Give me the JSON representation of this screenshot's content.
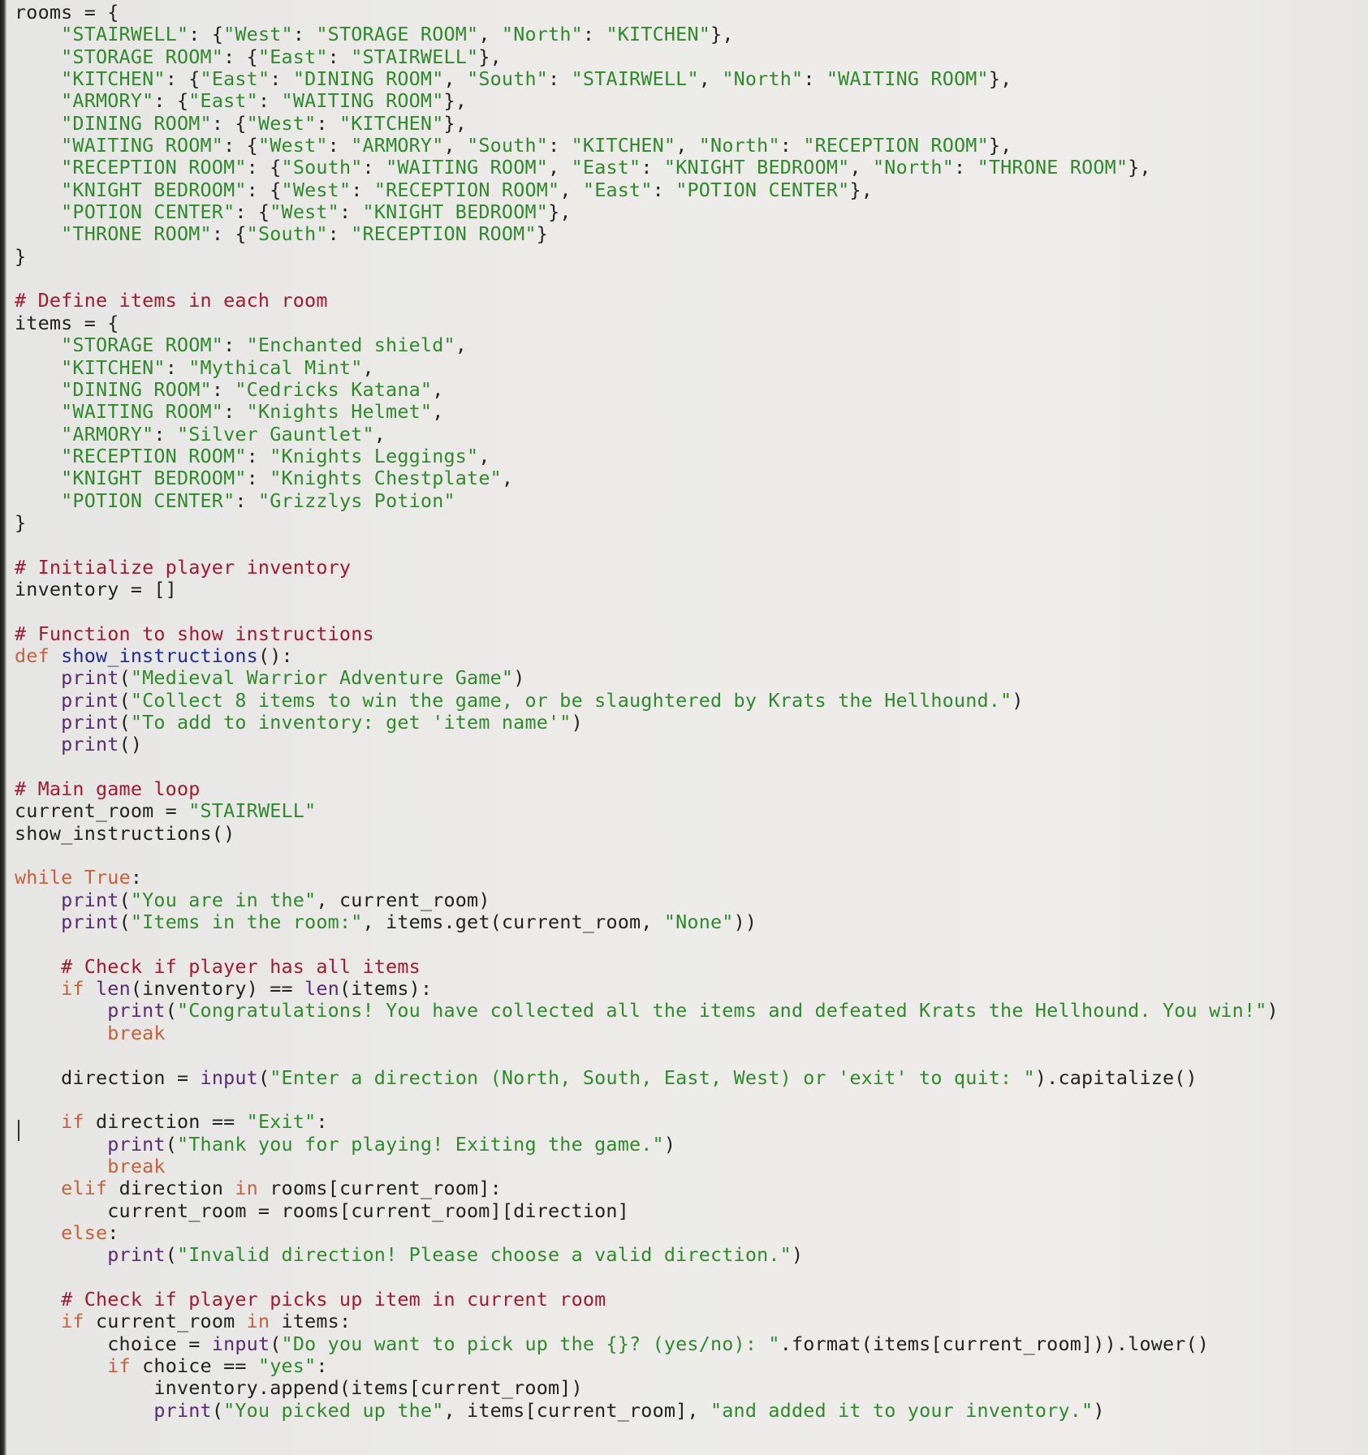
{
  "editor": {
    "language": "python",
    "colors": {
      "background": "#ecebe8",
      "plain": "#222222",
      "string": "#2f8a2c",
      "keyword": "#c9603a",
      "comment": "#a4192f",
      "builtin": "#5a2a72",
      "function_name": "#1f2b9a"
    },
    "lines": [
      [
        [
          "plain",
          "rooms = {"
        ]
      ],
      [
        [
          "plain",
          "    "
        ],
        [
          "str",
          "\"STAIRWELL\""
        ],
        [
          "plain",
          ": {"
        ],
        [
          "str",
          "\"West\""
        ],
        [
          "plain",
          ": "
        ],
        [
          "str",
          "\"STORAGE ROOM\""
        ],
        [
          "plain",
          ", "
        ],
        [
          "str",
          "\"North\""
        ],
        [
          "plain",
          ": "
        ],
        [
          "str",
          "\"KITCHEN\""
        ],
        [
          "plain",
          "},"
        ]
      ],
      [
        [
          "plain",
          "    "
        ],
        [
          "str",
          "\"STORAGE ROOM\""
        ],
        [
          "plain",
          ": {"
        ],
        [
          "str",
          "\"East\""
        ],
        [
          "plain",
          ": "
        ],
        [
          "str",
          "\"STAIRWELL\""
        ],
        [
          "plain",
          "},"
        ]
      ],
      [
        [
          "plain",
          "    "
        ],
        [
          "str",
          "\"KITCHEN\""
        ],
        [
          "plain",
          ": {"
        ],
        [
          "str",
          "\"East\""
        ],
        [
          "plain",
          ": "
        ],
        [
          "str",
          "\"DINING ROOM\""
        ],
        [
          "plain",
          ", "
        ],
        [
          "str",
          "\"South\""
        ],
        [
          "plain",
          ": "
        ],
        [
          "str",
          "\"STAIRWELL\""
        ],
        [
          "plain",
          ", "
        ],
        [
          "str",
          "\"North\""
        ],
        [
          "plain",
          ": "
        ],
        [
          "str",
          "\"WAITING ROOM\""
        ],
        [
          "plain",
          "},"
        ]
      ],
      [
        [
          "plain",
          "    "
        ],
        [
          "str",
          "\"ARMORY\""
        ],
        [
          "plain",
          ": {"
        ],
        [
          "str",
          "\"East\""
        ],
        [
          "plain",
          ": "
        ],
        [
          "str",
          "\"WAITING ROOM\""
        ],
        [
          "plain",
          "},"
        ]
      ],
      [
        [
          "plain",
          "    "
        ],
        [
          "str",
          "\"DINING ROOM\""
        ],
        [
          "plain",
          ": {"
        ],
        [
          "str",
          "\"West\""
        ],
        [
          "plain",
          ": "
        ],
        [
          "str",
          "\"KITCHEN\""
        ],
        [
          "plain",
          "},"
        ]
      ],
      [
        [
          "plain",
          "    "
        ],
        [
          "str",
          "\"WAITING ROOM\""
        ],
        [
          "plain",
          ": {"
        ],
        [
          "str",
          "\"West\""
        ],
        [
          "plain",
          ": "
        ],
        [
          "str",
          "\"ARMORY\""
        ],
        [
          "plain",
          ", "
        ],
        [
          "str",
          "\"South\""
        ],
        [
          "plain",
          ": "
        ],
        [
          "str",
          "\"KITCHEN\""
        ],
        [
          "plain",
          ", "
        ],
        [
          "str",
          "\"North\""
        ],
        [
          "plain",
          ": "
        ],
        [
          "str",
          "\"RECEPTION ROOM\""
        ],
        [
          "plain",
          "},"
        ]
      ],
      [
        [
          "plain",
          "    "
        ],
        [
          "str",
          "\"RECEPTION ROOM\""
        ],
        [
          "plain",
          ": {"
        ],
        [
          "str",
          "\"South\""
        ],
        [
          "plain",
          ": "
        ],
        [
          "str",
          "\"WAITING ROOM\""
        ],
        [
          "plain",
          ", "
        ],
        [
          "str",
          "\"East\""
        ],
        [
          "plain",
          ": "
        ],
        [
          "str",
          "\"KNIGHT BEDROOM\""
        ],
        [
          "plain",
          ", "
        ],
        [
          "str",
          "\"North\""
        ],
        [
          "plain",
          ": "
        ],
        [
          "str",
          "\"THRONE ROOM\""
        ],
        [
          "plain",
          "},"
        ]
      ],
      [
        [
          "plain",
          "    "
        ],
        [
          "str",
          "\"KNIGHT BEDROOM\""
        ],
        [
          "plain",
          ": {"
        ],
        [
          "str",
          "\"West\""
        ],
        [
          "plain",
          ": "
        ],
        [
          "str",
          "\"RECEPTION ROOM\""
        ],
        [
          "plain",
          ", "
        ],
        [
          "str",
          "\"East\""
        ],
        [
          "plain",
          ": "
        ],
        [
          "str",
          "\"POTION CENTER\""
        ],
        [
          "plain",
          "},"
        ]
      ],
      [
        [
          "plain",
          "    "
        ],
        [
          "str",
          "\"POTION CENTER\""
        ],
        [
          "plain",
          ": {"
        ],
        [
          "str",
          "\"West\""
        ],
        [
          "plain",
          ": "
        ],
        [
          "str",
          "\"KNIGHT BEDROOM\""
        ],
        [
          "plain",
          "},"
        ]
      ],
      [
        [
          "plain",
          "    "
        ],
        [
          "str",
          "\"THRONE ROOM\""
        ],
        [
          "plain",
          ": {"
        ],
        [
          "str",
          "\"South\""
        ],
        [
          "plain",
          ": "
        ],
        [
          "str",
          "\"RECEPTION ROOM\""
        ],
        [
          "plain",
          "}"
        ]
      ],
      [
        [
          "plain",
          "}"
        ]
      ],
      [],
      [
        [
          "com",
          "# Define items in each room"
        ]
      ],
      [
        [
          "plain",
          "items = {"
        ]
      ],
      [
        [
          "plain",
          "    "
        ],
        [
          "str",
          "\"STORAGE ROOM\""
        ],
        [
          "plain",
          ": "
        ],
        [
          "str",
          "\"Enchanted shield\""
        ],
        [
          "plain",
          ","
        ]
      ],
      [
        [
          "plain",
          "    "
        ],
        [
          "str",
          "\"KITCHEN\""
        ],
        [
          "plain",
          ": "
        ],
        [
          "str",
          "\"Mythical Mint\""
        ],
        [
          "plain",
          ","
        ]
      ],
      [
        [
          "plain",
          "    "
        ],
        [
          "str",
          "\"DINING ROOM\""
        ],
        [
          "plain",
          ": "
        ],
        [
          "str",
          "\"Cedricks Katana\""
        ],
        [
          "plain",
          ","
        ]
      ],
      [
        [
          "plain",
          "    "
        ],
        [
          "str",
          "\"WAITING ROOM\""
        ],
        [
          "plain",
          ": "
        ],
        [
          "str",
          "\"Knights Helmet\""
        ],
        [
          "plain",
          ","
        ]
      ],
      [
        [
          "plain",
          "    "
        ],
        [
          "str",
          "\"ARMORY\""
        ],
        [
          "plain",
          ": "
        ],
        [
          "str",
          "\"Silver Gauntlet\""
        ],
        [
          "plain",
          ","
        ]
      ],
      [
        [
          "plain",
          "    "
        ],
        [
          "str",
          "\"RECEPTION ROOM\""
        ],
        [
          "plain",
          ": "
        ],
        [
          "str",
          "\"Knights Leggings\""
        ],
        [
          "plain",
          ","
        ]
      ],
      [
        [
          "plain",
          "    "
        ],
        [
          "str",
          "\"KNIGHT BEDROOM\""
        ],
        [
          "plain",
          ": "
        ],
        [
          "str",
          "\"Knights Chestplate\""
        ],
        [
          "plain",
          ","
        ]
      ],
      [
        [
          "plain",
          "    "
        ],
        [
          "str",
          "\"POTION CENTER\""
        ],
        [
          "plain",
          ": "
        ],
        [
          "str",
          "\"Grizzlys Potion\""
        ]
      ],
      [
        [
          "plain",
          "}"
        ]
      ],
      [],
      [
        [
          "com",
          "# Initialize player inventory"
        ]
      ],
      [
        [
          "plain",
          "inventory = []"
        ]
      ],
      [],
      [
        [
          "com",
          "# Function to show instructions"
        ]
      ],
      [
        [
          "kw",
          "def"
        ],
        [
          "plain",
          " "
        ],
        [
          "def",
          "show_instructions"
        ],
        [
          "plain",
          "():"
        ]
      ],
      [
        [
          "plain",
          "    "
        ],
        [
          "bi",
          "print"
        ],
        [
          "plain",
          "("
        ],
        [
          "str",
          "\"Medieval Warrior Adventure Game\""
        ],
        [
          "plain",
          ")"
        ]
      ],
      [
        [
          "plain",
          "    "
        ],
        [
          "bi",
          "print"
        ],
        [
          "plain",
          "("
        ],
        [
          "str",
          "\"Collect 8 items to win the game, or be slaughtered by Krats the Hellhound.\""
        ],
        [
          "plain",
          ")"
        ]
      ],
      [
        [
          "plain",
          "    "
        ],
        [
          "bi",
          "print"
        ],
        [
          "plain",
          "("
        ],
        [
          "str",
          "\"To add to inventory: get 'item name'\""
        ],
        [
          "plain",
          ")"
        ]
      ],
      [
        [
          "plain",
          "    "
        ],
        [
          "bi",
          "print"
        ],
        [
          "plain",
          "()"
        ]
      ],
      [],
      [
        [
          "com",
          "# Main game loop"
        ]
      ],
      [
        [
          "plain",
          "current_room = "
        ],
        [
          "str",
          "\"STAIRWELL\""
        ]
      ],
      [
        [
          "plain",
          "show_instructions()"
        ]
      ],
      [],
      [
        [
          "kw",
          "while"
        ],
        [
          "plain",
          " "
        ],
        [
          "kw",
          "True"
        ],
        [
          "plain",
          ":"
        ]
      ],
      [
        [
          "plain",
          "    "
        ],
        [
          "bi",
          "print"
        ],
        [
          "plain",
          "("
        ],
        [
          "str",
          "\"You are in the\""
        ],
        [
          "plain",
          ", current_room)"
        ]
      ],
      [
        [
          "plain",
          "    "
        ],
        [
          "bi",
          "print"
        ],
        [
          "plain",
          "("
        ],
        [
          "str",
          "\"Items in the room:\""
        ],
        [
          "plain",
          ", items.get(current_room, "
        ],
        [
          "str",
          "\"None\""
        ],
        [
          "plain",
          "))"
        ]
      ],
      [],
      [
        [
          "plain",
          "    "
        ],
        [
          "com",
          "# Check if player has all items"
        ]
      ],
      [
        [
          "plain",
          "    "
        ],
        [
          "kw",
          "if"
        ],
        [
          "plain",
          " "
        ],
        [
          "bi",
          "len"
        ],
        [
          "plain",
          "(inventory) == "
        ],
        [
          "bi",
          "len"
        ],
        [
          "plain",
          "(items):"
        ]
      ],
      [
        [
          "plain",
          "        "
        ],
        [
          "bi",
          "print"
        ],
        [
          "plain",
          "("
        ],
        [
          "str",
          "\"Congratulations! You have collected all the items and defeated Krats the Hellhound. You win!\""
        ],
        [
          "plain",
          ")"
        ]
      ],
      [
        [
          "plain",
          "        "
        ],
        [
          "kw",
          "break"
        ]
      ],
      [],
      [
        [
          "plain",
          "    direction = "
        ],
        [
          "bi",
          "input"
        ],
        [
          "plain",
          "("
        ],
        [
          "str",
          "\"Enter a direction (North, South, East, West) or 'exit' to quit: \""
        ],
        [
          "plain",
          ").capitalize()"
        ]
      ],
      [],
      [
        [
          "plain",
          "    "
        ],
        [
          "kw",
          "if"
        ],
        [
          "plain",
          " direction == "
        ],
        [
          "str",
          "\"Exit\""
        ],
        [
          "plain",
          ":"
        ]
      ],
      [
        [
          "plain",
          "        "
        ],
        [
          "bi",
          "print"
        ],
        [
          "plain",
          "("
        ],
        [
          "str",
          "\"Thank you for playing! Exiting the game.\""
        ],
        [
          "plain",
          ")"
        ]
      ],
      [
        [
          "plain",
          "        "
        ],
        [
          "kw",
          "break"
        ]
      ],
      [
        [
          "plain",
          "    "
        ],
        [
          "kw",
          "elif"
        ],
        [
          "plain",
          " direction "
        ],
        [
          "kw",
          "in"
        ],
        [
          "plain",
          " rooms[current_room]:"
        ]
      ],
      [
        [
          "plain",
          "        current_room = rooms[current_room][direction]"
        ]
      ],
      [
        [
          "plain",
          "    "
        ],
        [
          "kw",
          "else"
        ],
        [
          "plain",
          ":"
        ]
      ],
      [
        [
          "plain",
          "        "
        ],
        [
          "bi",
          "print"
        ],
        [
          "plain",
          "("
        ],
        [
          "str",
          "\"Invalid direction! Please choose a valid direction.\""
        ],
        [
          "plain",
          ")"
        ]
      ],
      [],
      [
        [
          "plain",
          "    "
        ],
        [
          "com",
          "# Check if player picks up item in current room"
        ]
      ],
      [
        [
          "plain",
          "    "
        ],
        [
          "kw",
          "if"
        ],
        [
          "plain",
          " current_room "
        ],
        [
          "kw",
          "in"
        ],
        [
          "plain",
          " items:"
        ]
      ],
      [
        [
          "plain",
          "        choice = "
        ],
        [
          "bi",
          "input"
        ],
        [
          "plain",
          "("
        ],
        [
          "str",
          "\"Do you want to pick up the {}? (yes/no): \""
        ],
        [
          "plain",
          ".format(items[current_room])).lower()"
        ]
      ],
      [
        [
          "plain",
          "        "
        ],
        [
          "kw",
          "if"
        ],
        [
          "plain",
          " choice == "
        ],
        [
          "str",
          "\"yes\""
        ],
        [
          "plain",
          ":"
        ]
      ],
      [
        [
          "plain",
          "            inventory.append(items[current_room])"
        ]
      ],
      [
        [
          "plain",
          "            "
        ],
        [
          "bi",
          "print"
        ],
        [
          "plain",
          "("
        ],
        [
          "str",
          "\"You picked up the\""
        ],
        [
          "plain",
          ", items[current_room], "
        ],
        [
          "str",
          "\"and added it to your inventory.\""
        ],
        [
          "plain",
          ")"
        ]
      ]
    ]
  }
}
